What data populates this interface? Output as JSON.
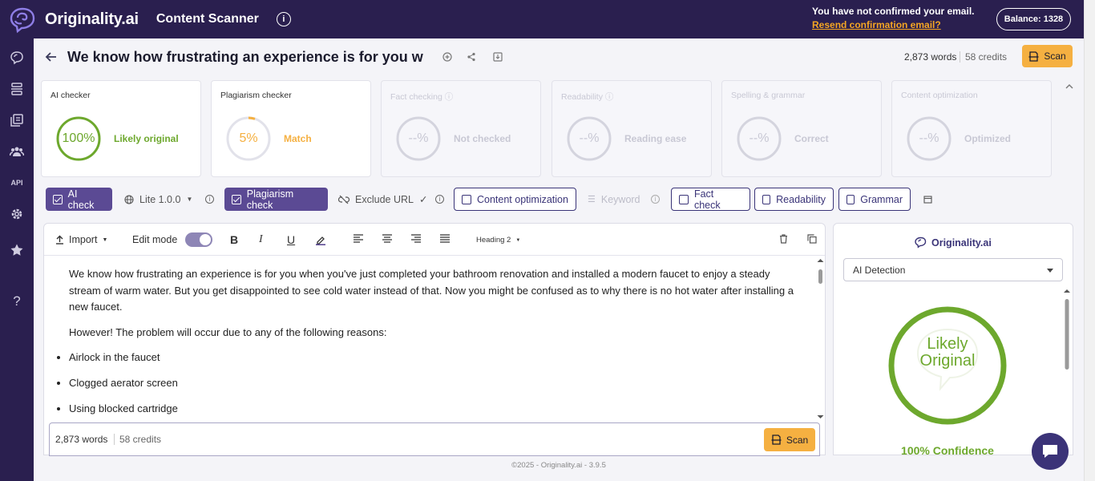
{
  "topbar": {
    "brand": "Originality.ai",
    "app_name": "Content Scanner",
    "email_notice": "You have not confirmed your email.",
    "resend_link": "Resend confirmation email?",
    "balance": "Balance: 1328"
  },
  "sidebar": {
    "items": [
      "brain-icon",
      "scanner-icon",
      "library-icon",
      "team-icon",
      "API",
      "gear-icon",
      "star-icon",
      "?"
    ]
  },
  "header": {
    "title": "We know how frustrating an experience is for you w",
    "word_count": "2,873 words",
    "credits": "58 credits",
    "scan_label": "Scan"
  },
  "cards": [
    {
      "label": "AI checker",
      "value": "100%",
      "status": "Likely original",
      "color": "#6da82d",
      "fraction": 1.0
    },
    {
      "label": "Plagiarism checker",
      "value": "5%",
      "status": "Match",
      "color": "#f5b041",
      "fraction": 0.05
    },
    {
      "label": "Fact checking",
      "value": "--%",
      "status": "Not checked"
    },
    {
      "label": "Readability",
      "value": "--%",
      "status": "Reading ease"
    },
    {
      "label": "Spelling & grammar",
      "value": "--%",
      "status": "Correct"
    },
    {
      "label": "Content optimization",
      "value": "--%",
      "status": "Optimized"
    }
  ],
  "toolbar": {
    "ai_check": "AI check",
    "model": "Lite 1.0.0",
    "plagiarism_check": "Plagiarism check",
    "exclude_url": "Exclude URL",
    "content_optimization": "Content optimization",
    "keyword": "Keyword",
    "fact_check": "Fact check",
    "readability": "Readability",
    "grammar": "Grammar"
  },
  "editor": {
    "import": "Import",
    "edit_mode": "Edit mode",
    "heading": "Heading 2",
    "paragraph1": "We know how frustrating an experience is for you when you've just completed your bathroom renovation and installed a modern faucet to enjoy a steady stream of warm water. But you get disappointed to see cold water instead of that. Now you might be confused as to why there is no hot water after installing a new faucet.",
    "paragraph2": "However! The problem will occur due to any of the following reasons:",
    "bullets": [
      "Airlock in the faucet",
      "Clogged aerator screen",
      "Using blocked cartridge"
    ],
    "footer_words": "2,873 words",
    "footer_credits": "58 credits",
    "footer_scan": "Scan"
  },
  "right_panel": {
    "brand": "Originality.ai",
    "select_value": "AI Detection",
    "result_line1": "Likely",
    "result_line2": "Original",
    "confidence": "100% Confidence"
  },
  "footer": "©2025 - Originality.ai - 3.9.5"
}
